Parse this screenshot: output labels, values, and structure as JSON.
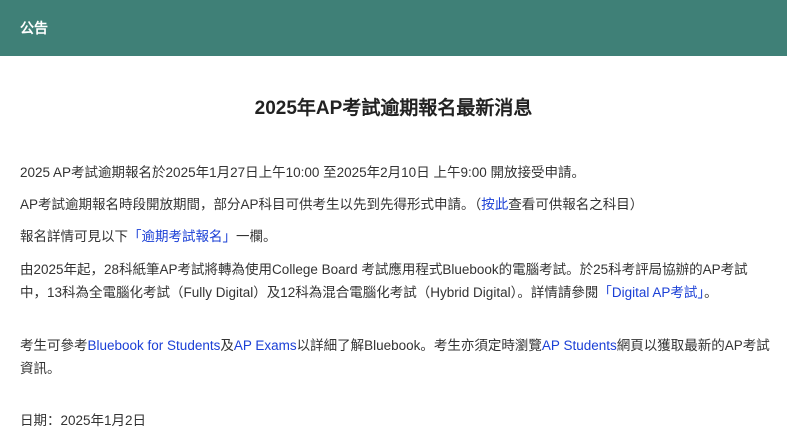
{
  "header": {
    "title": "公告"
  },
  "page": {
    "title": "2025年AP考試逾期報名最新消息"
  },
  "p1": {
    "text": "2025 AP考試逾期報名於2025年1月27日上午10:00 至2025年2月10日 上午9:00 開放接受申請。"
  },
  "p2": {
    "pre": "AP考試逾期報名時段開放期間，部分AP科目可供考生以先到先得形式申請。（",
    "link": "按此",
    "post": "查看可供報名之科目）"
  },
  "p3": {
    "pre": "報名詳情可見以下",
    "link": "「逾期考試報名」",
    "post": "一欄。"
  },
  "p4": {
    "pre": "由2025年起，28科紙筆AP考試將轉為使用College Board 考試應用程式Bluebook的電腦考試。於25科考評局協辦的AP考試中，13科為全電腦化考試（Fully Digital）及12科為混合電腦化考試（Hybrid Digital）。詳情請參閱",
    "link": "「Digital AP考試」",
    "post": "。"
  },
  "p5": {
    "pre": "考生可參考",
    "link1": "Bluebook for Students",
    "mid1": "及",
    "link2": "AP Exams",
    "mid2": "以詳細了解Bluebook。考生亦須定時瀏覽",
    "link3": "AP Students",
    "post": "網頁以獲取最新的AP考試資訊。"
  },
  "p6": {
    "text": "日期：2025年1月2日"
  }
}
